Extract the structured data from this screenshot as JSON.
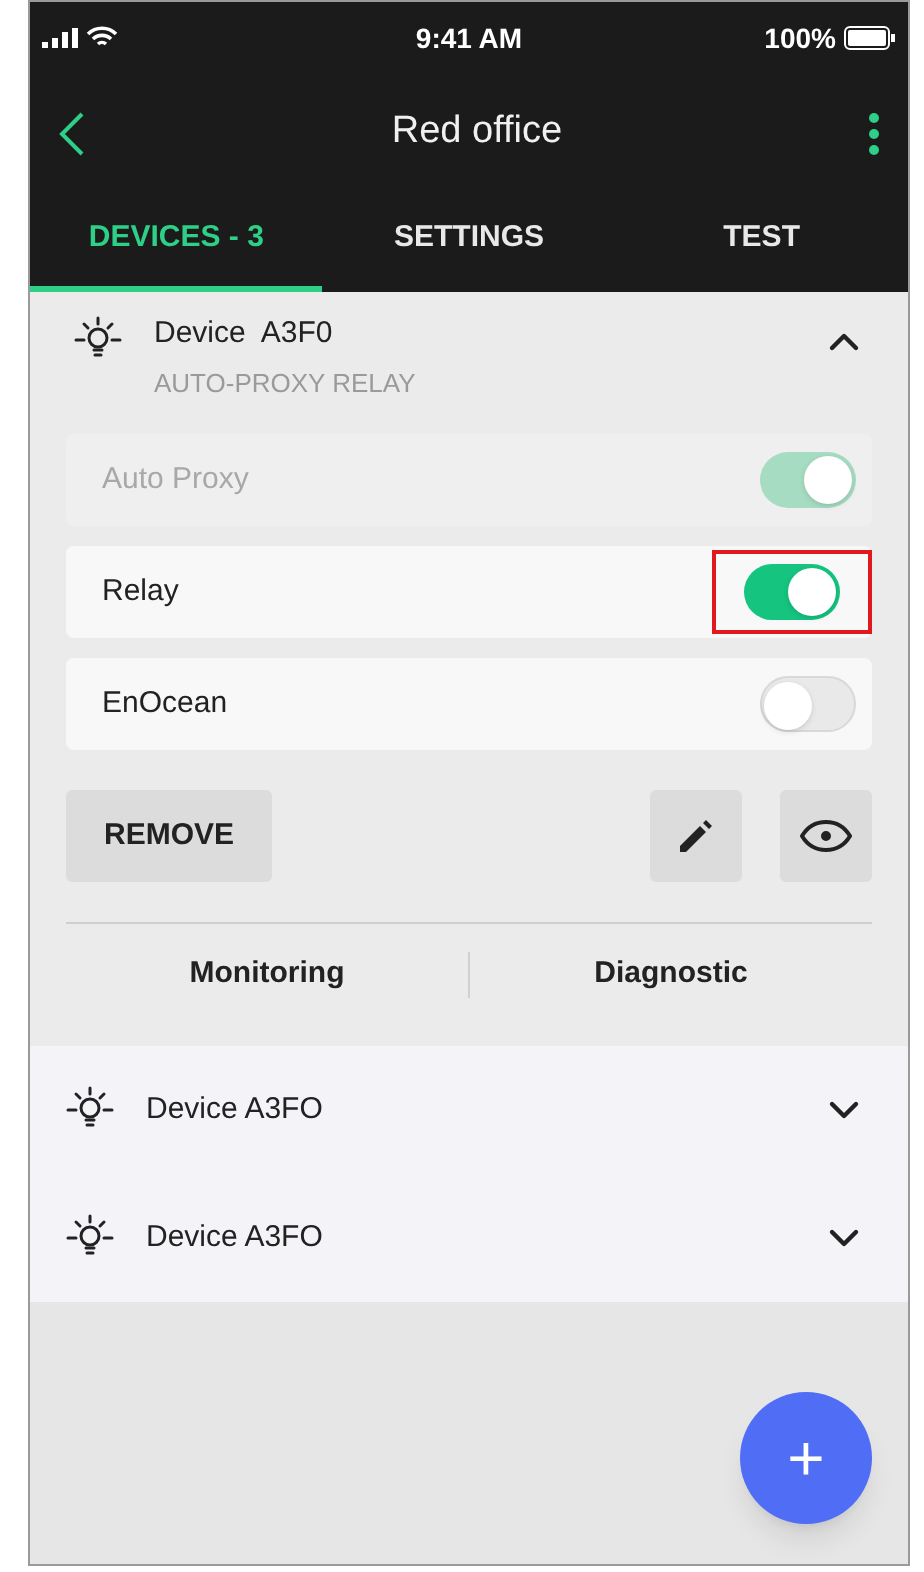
{
  "status_bar": {
    "time": "9:41 AM",
    "battery": "100%"
  },
  "header": {
    "title": "Red office"
  },
  "tabs": [
    {
      "label": "DEVICES - 3",
      "selected": true
    },
    {
      "label": "SETTINGS",
      "selected": false
    },
    {
      "label": "TEST",
      "selected": false
    }
  ],
  "devices": [
    {
      "name": "Device  A3F0",
      "subtitle": "AUTO-PROXY RELAY",
      "expanded": true,
      "options": [
        {
          "label": "Auto Proxy",
          "on": true,
          "disabled": true,
          "highlighted": false
        },
        {
          "label": "Relay",
          "on": true,
          "disabled": false,
          "highlighted": true
        },
        {
          "label": "EnOcean",
          "on": false,
          "disabled": false,
          "highlighted": false
        }
      ],
      "remove_button": "REMOVE",
      "links": [
        "Monitoring",
        "Diagnostic"
      ]
    },
    {
      "name": "Device A3FO",
      "expanded": false
    },
    {
      "name": "Device A3FO",
      "expanded": false
    }
  ],
  "fab": {
    "label": "+"
  }
}
